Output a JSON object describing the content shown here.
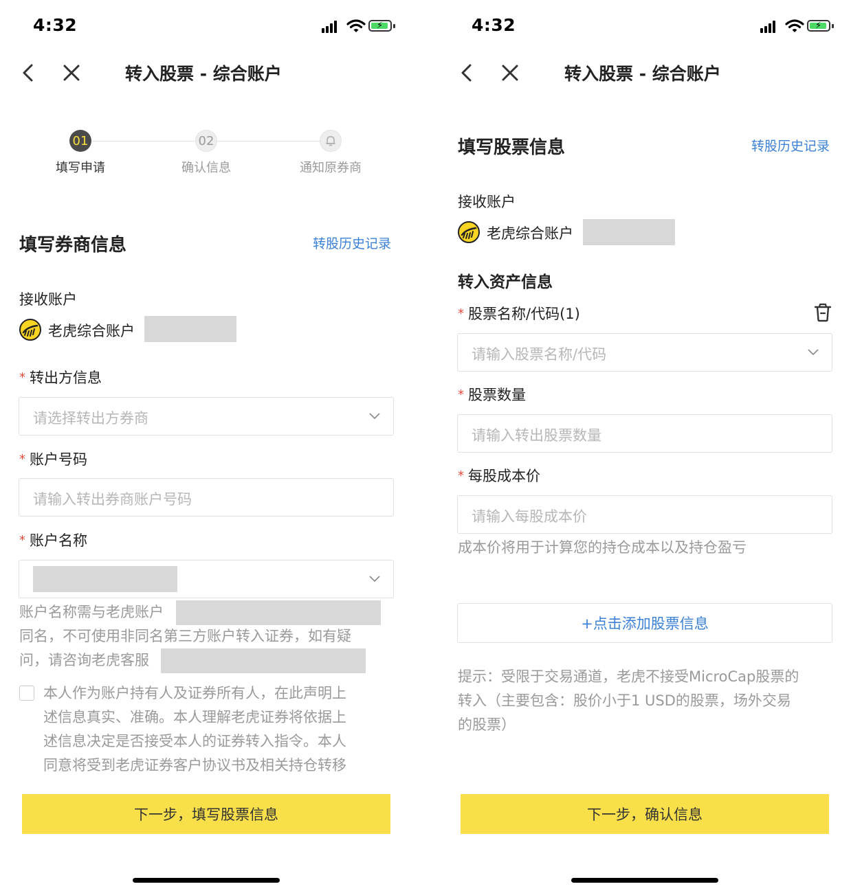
{
  "status": {
    "time": "4:32"
  },
  "left": {
    "nav_title": "转入股票 - 综合账户",
    "steps": [
      {
        "number": "01",
        "label": "填写申请"
      },
      {
        "number": "02",
        "label": "确认信息"
      },
      {
        "number": "",
        "label": "通知原券商"
      }
    ],
    "section_title": "填写券商信息",
    "history_link": "转股历史记录",
    "receive_label": "接收账户",
    "receive_account_name": "老虎综合账户",
    "fields": {
      "broker": {
        "label": "转出方信息",
        "placeholder": "请选择转出方券商"
      },
      "account_number": {
        "label": "账户号码",
        "placeholder": "请输入转出券商账户号码"
      },
      "account_name": {
        "label": "账户名称"
      }
    },
    "name_note": {
      "line1": "账户名称需与老虎账户",
      "line2": "同名，不可使用非同名第三方账户转入证券，如有疑",
      "line3": "问，请咨询老虎客服"
    },
    "declaration": [
      "本人作为账户持有人及证券所有人，在此声明上",
      "述信息真实、准确。本人理解老虎证券将依据上",
      "述信息决定是否接受本人的证券转入指令。本人",
      "同意将受到老虎证券客户协议书及相关持仓转移"
    ],
    "next_button": "下一步，填写股票信息"
  },
  "right": {
    "nav_title": "转入股票 - 综合账户",
    "section_title": "填写股票信息",
    "history_link": "转股历史记录",
    "receive_label": "接收账户",
    "receive_account_name": "老虎综合账户",
    "asset_title": "转入资产信息",
    "fields": {
      "stock": {
        "label": "股票名称/代码(1)",
        "placeholder": "请输入股票名称/代码"
      },
      "quantity": {
        "label": "股票数量",
        "placeholder": "请输入转出股票数量"
      },
      "cost": {
        "label": "每股成本价",
        "placeholder": "请输入每股成本价"
      }
    },
    "cost_note": "成本价将用于计算您的持仓成本以及持仓盈亏",
    "add_button": "+点击添加股票信息",
    "tip": [
      "提示：受限于交易通道，老虎不接受MicroCap股票的",
      "转入（主要包含：股价小于1 USD的股票，场外交易",
      "的股票）"
    ],
    "next_button": "下一步，确认信息"
  },
  "colors": {
    "accent_yellow": "#f9e04b",
    "link_blue": "#3b82d6",
    "required_red": "#e24a3b",
    "step_active": "#4a4a4a"
  },
  "icons": [
    "back-chevron-icon",
    "close-icon",
    "bell-icon",
    "tiger-logo-icon",
    "chevron-down-icon",
    "trash-icon",
    "signal-icon",
    "wifi-icon",
    "battery-icon"
  ]
}
